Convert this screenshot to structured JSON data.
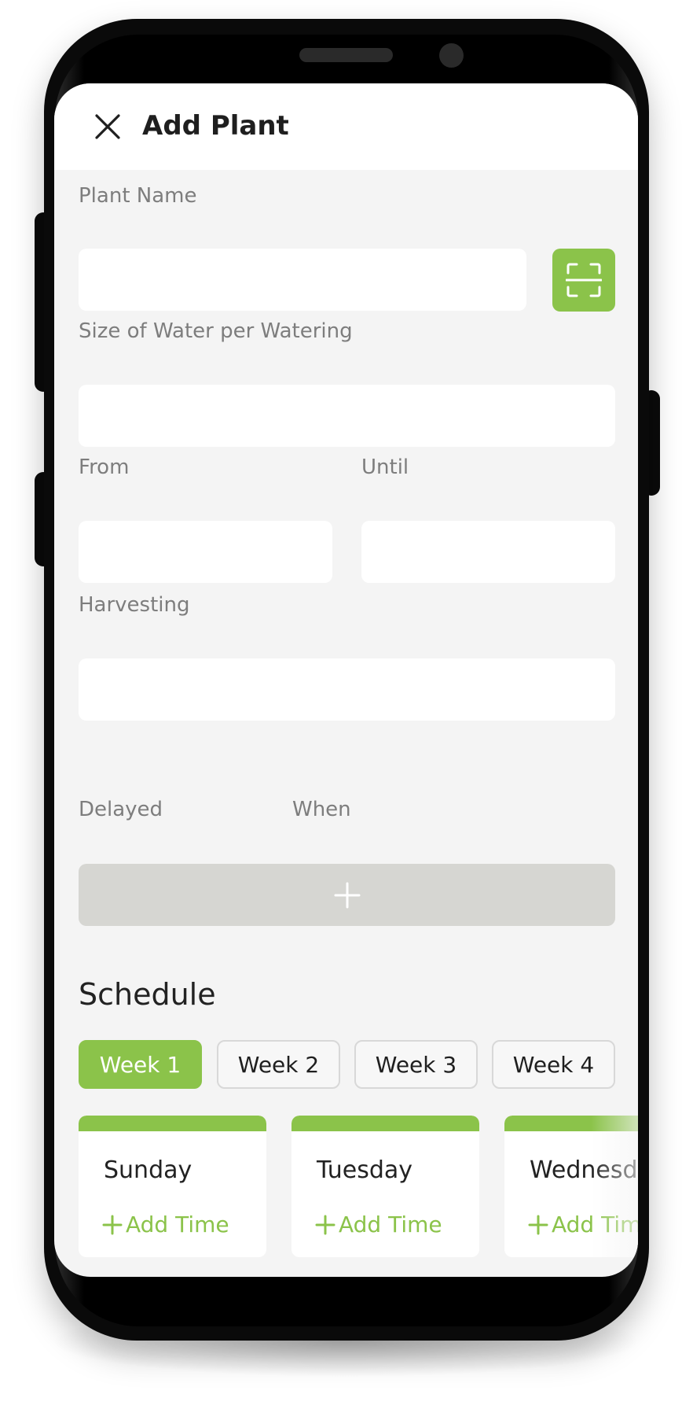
{
  "header": {
    "title": "Add Plant",
    "close_icon": "close-icon"
  },
  "form": {
    "plant_name": {
      "label": "Plant Name",
      "value": "",
      "placeholder": ""
    },
    "scan_icon": "scan-icon",
    "water_size": {
      "label": "Size of Water per Watering",
      "value": "",
      "placeholder": ""
    },
    "from": {
      "label": "From",
      "value": "",
      "placeholder": ""
    },
    "until": {
      "label": "Until",
      "value": "",
      "placeholder": ""
    },
    "harvesting": {
      "label": "Harvesting",
      "value": "",
      "placeholder": ""
    },
    "delayed": {
      "label": "Delayed"
    },
    "when": {
      "label": "When"
    },
    "add_delay_icon": "plus-icon"
  },
  "schedule": {
    "title": "Schedule",
    "weeks": [
      {
        "label": "Week 1",
        "active": true
      },
      {
        "label": "Week 2",
        "active": false
      },
      {
        "label": "Week 3",
        "active": false
      },
      {
        "label": "Week 4",
        "active": false
      }
    ],
    "days": [
      {
        "name": "Sunday",
        "add_time_label": "Add Time"
      },
      {
        "name": "Tuesday",
        "add_time_label": "Add Time"
      },
      {
        "name": "Wednesday",
        "add_time_label": "Add Time"
      }
    ]
  },
  "colors": {
    "accent": "#8bc34a",
    "background": "#f4f4f4",
    "delay_button": "#d6d6d2",
    "label": "#7d7d7d",
    "text": "#1f1f1f"
  }
}
